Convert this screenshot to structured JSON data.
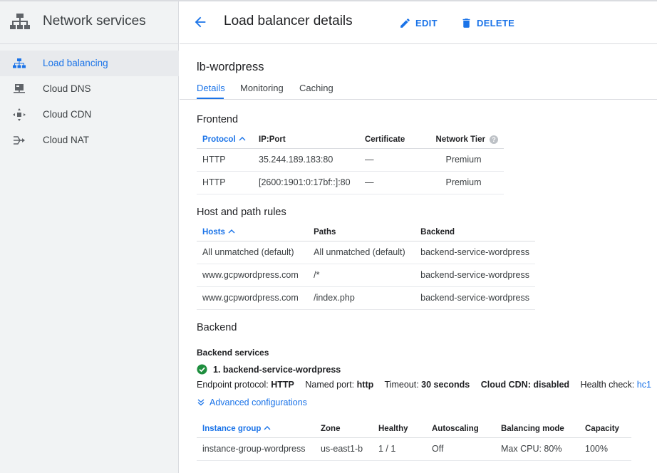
{
  "sidebar": {
    "title": "Network services",
    "items": [
      {
        "label": "Load balancing",
        "icon": "load-balancing-icon"
      },
      {
        "label": "Cloud DNS",
        "icon": "cloud-dns-icon"
      },
      {
        "label": "Cloud CDN",
        "icon": "cloud-cdn-icon"
      },
      {
        "label": "Cloud NAT",
        "icon": "cloud-nat-icon"
      }
    ]
  },
  "header": {
    "title": "Load balancer details",
    "edit_label": "EDIT",
    "delete_label": "DELETE"
  },
  "lb_name": "lb-wordpress",
  "tabs": [
    {
      "label": "Details"
    },
    {
      "label": "Monitoring"
    },
    {
      "label": "Caching"
    }
  ],
  "frontend": {
    "title": "Frontend",
    "columns": [
      "Protocol",
      "IP:Port",
      "Certificate",
      "Network Tier"
    ],
    "rows": [
      [
        "HTTP",
        "35.244.189.183:80",
        "—",
        "Premium"
      ],
      [
        "HTTP",
        "[2600:1901:0:17bf::]:80",
        "—",
        "Premium"
      ]
    ]
  },
  "host_rules": {
    "title": "Host and path rules",
    "columns": [
      "Hosts",
      "Paths",
      "Backend"
    ],
    "rows": [
      [
        "All unmatched (default)",
        "All unmatched (default)",
        "backend-service-wordpress"
      ],
      [
        "www.gcpwordpress.com",
        "/*",
        "backend-service-wordpress"
      ],
      [
        "www.gcpwordpress.com",
        "/index.php",
        "backend-service-wordpress"
      ]
    ]
  },
  "backend": {
    "title": "Backend",
    "subtitle": "Backend services",
    "service_name": "1. backend-service-wordpress",
    "endpoint_protocol_label": "Endpoint protocol:",
    "endpoint_protocol": "HTTP",
    "named_port_label": "Named port:",
    "named_port": "http",
    "timeout_label": "Timeout:",
    "timeout": "30 seconds",
    "cdn_label": "Cloud CDN:",
    "cdn": "disabled",
    "health_check_label": "Health check:",
    "health_check": "hc1",
    "advanced_label": "Advanced configurations",
    "columns": [
      "Instance group",
      "Zone",
      "Healthy",
      "Autoscaling",
      "Balancing mode",
      "Capacity"
    ],
    "rows": [
      [
        "instance-group-wordpress",
        "us-east1-b",
        "1 / 1",
        "Off",
        "Max CPU: 80%",
        "100%"
      ]
    ]
  },
  "colors": {
    "accent": "#1a73e8",
    "success": "#1e8e3e",
    "sidebar_bg": "#f1f3f4"
  }
}
